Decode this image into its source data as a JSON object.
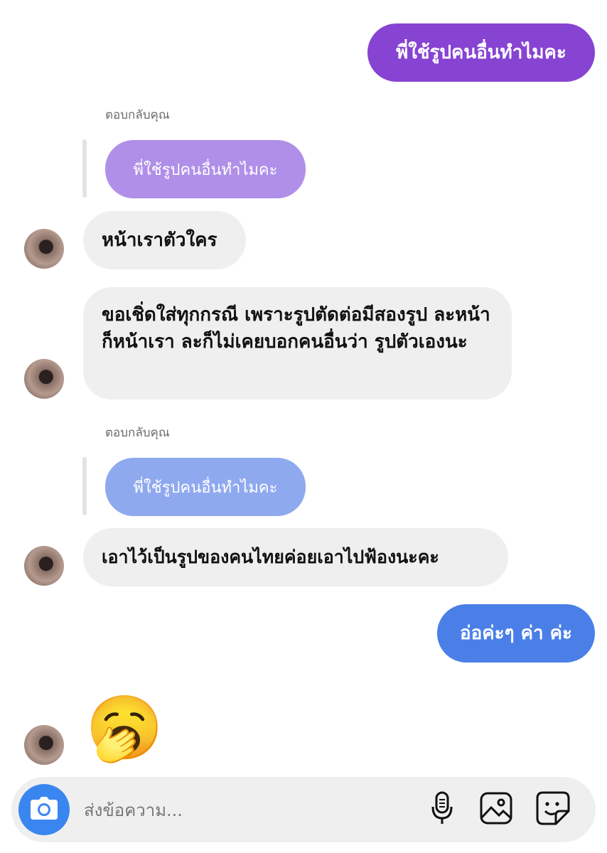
{
  "colors": {
    "outgoing_purple": "#8743d2",
    "outgoing_blue": "#4a7fe7",
    "quoted_purple": "#b08fe8",
    "quoted_blue": "#8fa9ef",
    "incoming": "#efefef",
    "camera_button": "#3a86f0"
  },
  "messages": {
    "out1": "พี่ใช้รูปคนอื่นทำไมคะ",
    "reply1_label": "ตอบกลับคุณ",
    "reply1_quote": "พี่ใช้รูปคนอื่นทำไมคะ",
    "in1": "หน้าเราตัวใคร",
    "in2": "ขอเชิ่ดใส่ทุกกรณี เพราะรูปตัดต่อมีสองรูป ละหน้าก็หน้าเรา ละก็ไม่เคยบอกคนอื่นว่า รูปตัวเองนะ",
    "reply2_label": "ตอบกลับคุณ",
    "reply2_quote": "พี่ใช้รูปคนอื่นทำไมคะ",
    "in3": "เอาไว้เป็นรูปของคนไทยค่อยเอาไปฟ้องนะคะ",
    "out2": "อ่อค่ะๆ ค่า ค่ะ",
    "emoji": "🥱"
  },
  "composer": {
    "placeholder": "ส่งข้อความ...",
    "icons": [
      "camera-icon",
      "microphone-icon",
      "image-icon",
      "sticker-icon"
    ]
  }
}
